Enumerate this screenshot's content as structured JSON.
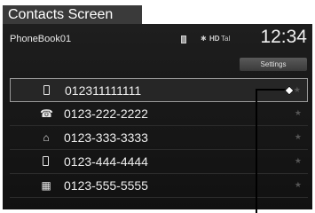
{
  "caption": {
    "title": "Contacts Screen"
  },
  "header": {
    "phonebook_name": "PhoneBook01",
    "clock": "12:34",
    "hd_label": "HD",
    "signal": "Tal"
  },
  "toolbar": {
    "settings_label": "Settings"
  },
  "contacts": [
    {
      "type_icon": "mobile-phone-icon",
      "number": "012311111111"
    },
    {
      "type_icon": "landline-phone-icon",
      "number": "0123-222-2222"
    },
    {
      "type_icon": "home-icon",
      "number": "0123-333-3333"
    },
    {
      "type_icon": "mobile-phone-icon",
      "number": "0123-444-4444"
    },
    {
      "type_icon": "office-building-icon",
      "number": "0123-555-5555"
    }
  ],
  "colors": {
    "screen_background": "#141414",
    "caption_background": "#3a3a3a",
    "text": "#eeeeee",
    "selected_border": "#9a9a9a"
  }
}
